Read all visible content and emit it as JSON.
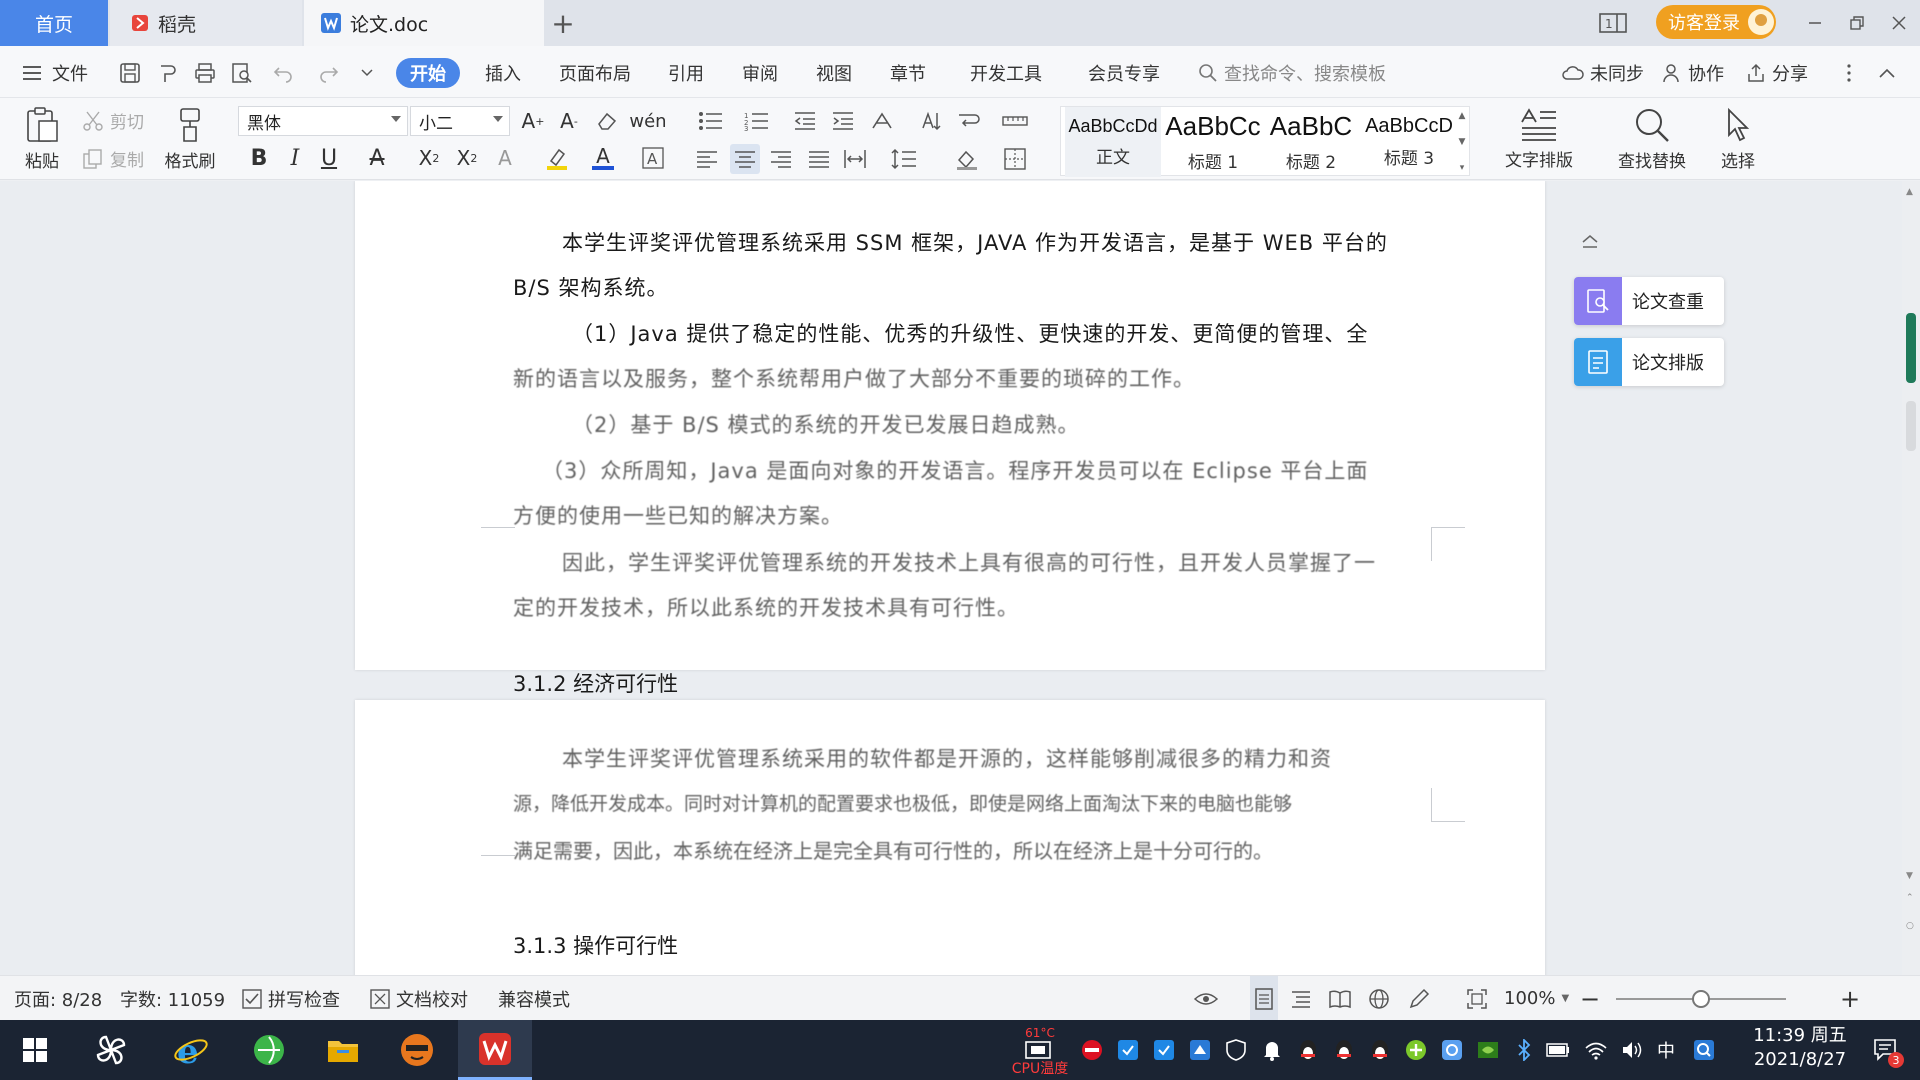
{
  "titlebar": {
    "tab_home": "首页",
    "tab_daoke": "稻壳",
    "tab_doc": "论文.doc",
    "login_label": "访客登录"
  },
  "menu": {
    "file": "文件",
    "items": [
      "开始",
      "插入",
      "页面布局",
      "引用",
      "审阅",
      "视图",
      "章节",
      "开发工具",
      "会员专享"
    ],
    "search_placeholder": "查找命令、搜索模板",
    "unsynced": "未同步",
    "collab": "协作",
    "share": "分享"
  },
  "ribbon": {
    "paste": "粘贴",
    "cut": "剪切",
    "copy": "复制",
    "format_painter": "格式刷",
    "font_name": "黑体",
    "font_size": "小二",
    "styles": [
      {
        "sample": "AaBbCcDd",
        "name": "正文"
      },
      {
        "sample": "AaBbCc",
        "name": "标题 1"
      },
      {
        "sample": "AaBbC",
        "name": "标题 2"
      },
      {
        "sample": "AaBbCcD",
        "name": "标题 3"
      }
    ],
    "text_layout": "文字排版",
    "find_replace": "查找替换",
    "select": "选择"
  },
  "document": {
    "page1": [
      "本学生评奖评优管理系统采用 SSM 框架，JAVA 作为开发语言，是基于 WEB 平台的",
      "B/S 架构系统。",
      "（1）Java 提供了稳定的性能、优秀的升级性、更快速的开发、更简便的管理、全",
      "新的语言以及服务，整个系统帮用户做了大部分不重要的琐碎的工作。",
      "（2）基于 B/S 模式的系统的开发已发展日趋成熟。",
      "（3）众所周知，Java 是面向对象的开发语言。程序开发员可以在 Eclipse 平台上面",
      "方便的使用一些已知的解决方案。",
      "因此，学生评奖评优管理系统的开发技术上具有很高的可行性，且开发人员掌握了一",
      "定的开发技术，所以此系统的开发技术具有可行性。"
    ],
    "heading_312": "3.1.2 经济可行性",
    "page2": [
      "本学生评奖评优管理系统采用的软件都是开源的，这样能够削减很多的精力和资",
      "源，降低开发成本。同时对计算机的配置要求也极低，即使是网络上面淘汰下来的电脑也能够",
      "满足需要，因此，本系统在经济上是完全具有可行性的，所以在经济上是十分可行的。"
    ],
    "heading_313": "3.1.3 操作可行性"
  },
  "side_panel": {
    "check": "论文查重",
    "layout": "论文排版"
  },
  "status": {
    "page": "页面: 8/28",
    "words": "字数: 11059",
    "spell": "拼写检查",
    "proof": "文档校对",
    "compat": "兼容模式",
    "zoom": "100%",
    "zoom_level": 0.5
  },
  "taskbar": {
    "cpu_label": "CPU温度",
    "cpu_temp": "61°C",
    "ime": "中",
    "time": "11:39 周五",
    "date": "2021/8/27",
    "notifications": "3"
  },
  "colors": {
    "accent": "#4a86e8",
    "login": "#f0a020",
    "taskbar": "#1b2433",
    "side_check": "#8a7cf0",
    "side_layout": "#3aa0e8"
  }
}
